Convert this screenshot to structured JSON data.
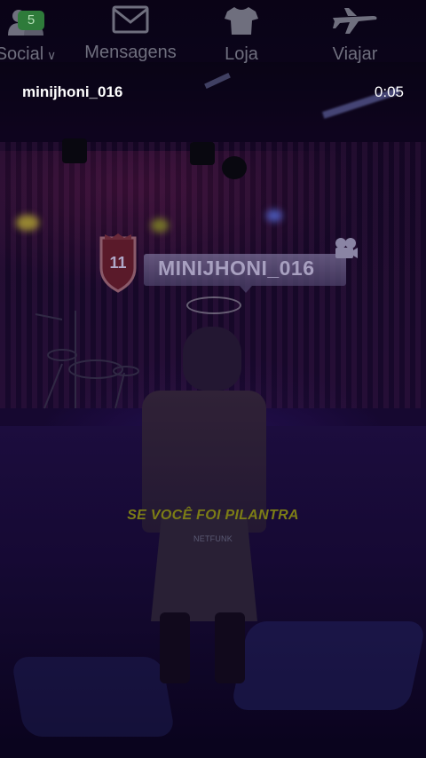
{
  "game_nav": {
    "items": [
      {
        "label": "Social",
        "icon": "people-icon",
        "badge": "5"
      },
      {
        "label": "Mensagens",
        "icon": "envelope-icon"
      },
      {
        "label": "Loja",
        "icon": "tshirt-icon"
      },
      {
        "label": "Viajar",
        "icon": "airplane-icon"
      }
    ]
  },
  "video": {
    "uploader": "minijhoni_016",
    "timestamp": "0:05"
  },
  "player_tag": {
    "level": "11",
    "name": "MINIJHONI_016",
    "icons": [
      "shield-icon",
      "camera-icon"
    ]
  },
  "captions": {
    "lyric": "SE VOCÊ FOI PILANTRA",
    "credit": "NETFUNK"
  },
  "colors": {
    "badge": "#2e7b3a",
    "lyric": "#7c7d16",
    "nav_text": "#6f6f7e"
  }
}
